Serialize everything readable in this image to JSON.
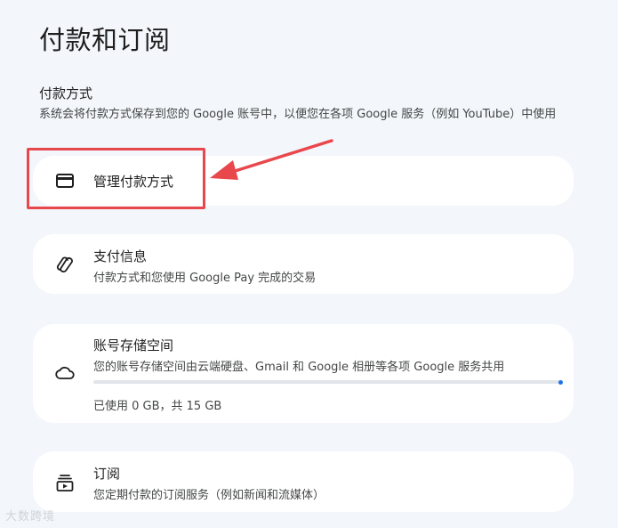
{
  "page": {
    "title": "付款和订阅"
  },
  "payment_methods": {
    "heading": "付款方式",
    "description": "系统会将付款方式保存到您的 Google 账号中，以便您在各项 Google 服务（例如 YouTube）中使用"
  },
  "cards": {
    "manage": {
      "title": "管理付款方式",
      "icon": "credit-card-icon"
    },
    "payinfo": {
      "title": "支付信息",
      "subtitle": "付款方式和您使用 Google Pay 完成的交易",
      "icon": "google-pay-icon"
    },
    "storage": {
      "title": "账号存储空间",
      "subtitle": "您的账号存储空间由云端硬盘、Gmail 和 Google 相册等各项 Google 服务共用",
      "usage": "已使用 0 GB，共 15 GB",
      "used_fraction": 0,
      "icon": "cloud-icon"
    },
    "subscriptions": {
      "title": "订阅",
      "subtitle": "您定期付款的订阅服务（例如新闻和流媒体）",
      "icon": "subscriptions-icon"
    }
  },
  "annotation": {
    "color": "#e8474c"
  },
  "colors": {
    "accent": "#1a73e8",
    "background": "#f3f6fb",
    "card": "#ffffff"
  },
  "watermark": "大数跨境"
}
